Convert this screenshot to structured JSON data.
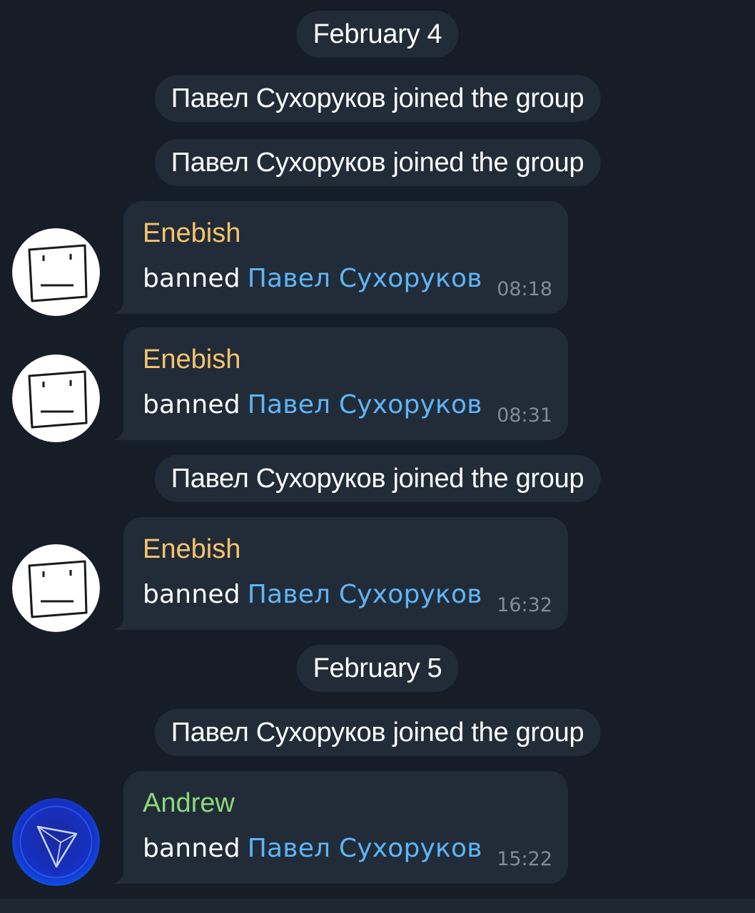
{
  "colors": {
    "background": "#161d27",
    "bubble": "#222c38",
    "sender_enebish": "#f7c46c",
    "sender_andrew": "#8ad97a",
    "mention": "#5eb5f7",
    "timestamp": "#7f8c99"
  },
  "items": [
    {
      "kind": "date",
      "text": "February 4"
    },
    {
      "kind": "service",
      "text": "Павел Сухоруков joined the group"
    },
    {
      "kind": "service",
      "text": "Павел Сухоруков joined the group"
    },
    {
      "kind": "message",
      "sender": "Enebish",
      "action": "banned",
      "mention": "Павел Сухоруков",
      "time": "08:18",
      "avatar": "sketch-face-avatar"
    },
    {
      "kind": "message",
      "sender": "Enebish",
      "action": "banned",
      "mention": "Павел Сухоруков",
      "time": "08:31",
      "avatar": "sketch-face-avatar"
    },
    {
      "kind": "service",
      "text": "Павел Сухоруков joined the group"
    },
    {
      "kind": "message",
      "sender": "Enebish",
      "action": "banned",
      "mention": "Павел Сухоруков",
      "time": "16:32",
      "avatar": "sketch-face-avatar"
    },
    {
      "kind": "date",
      "text": "February 5"
    },
    {
      "kind": "service",
      "text": "Павел Сухоруков joined the group"
    },
    {
      "kind": "message",
      "sender": "Andrew",
      "action": "banned",
      "mention": "Павел Сухоруков",
      "time": "15:22",
      "avatar": "tron-logo-avatar"
    }
  ]
}
